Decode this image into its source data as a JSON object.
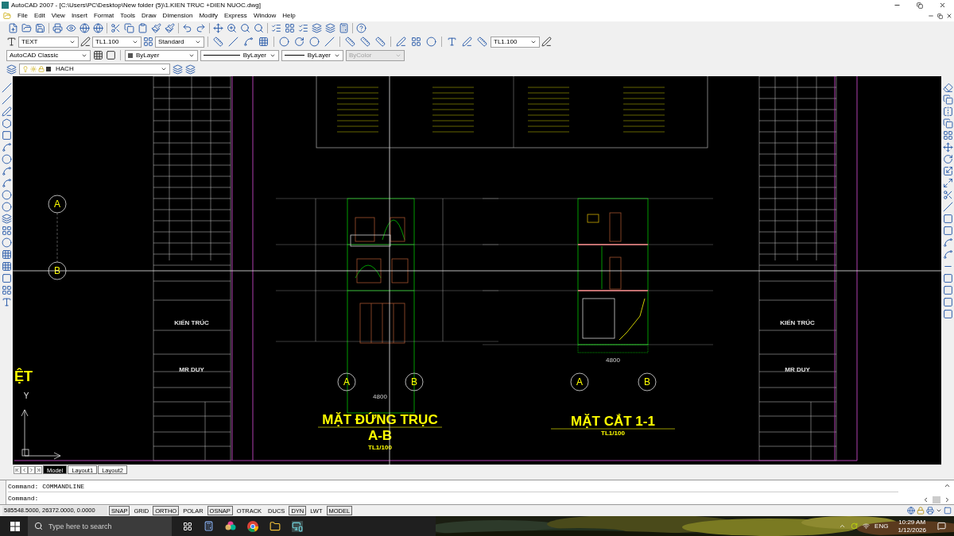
{
  "window": {
    "title": "AutoCAD 2007 - [C:\\Users\\PC\\Desktop\\New folder (5)\\1.KIEN TRUC +DIEN NUOC.dwg]"
  },
  "menu": [
    "File",
    "Edit",
    "View",
    "Insert",
    "Format",
    "Tools",
    "Draw",
    "Dimension",
    "Modify",
    "Express",
    "Window",
    "Help"
  ],
  "toolbars": {
    "text_style": "TEXT",
    "dim_style": "TL1.100",
    "table_style": "Standard",
    "multileader_style": "TL1.100",
    "workspace": "AutoCAD Classic",
    "object_color": "ByLayer",
    "linetype": "ByLayer",
    "lineweight": "ByLayer",
    "plot_style": {
      "value": "ByColor",
      "disabled": true
    },
    "layer": "HACH"
  },
  "drawing": {
    "left_label": "ỆT",
    "ucs_label": "Y",
    "grid_axes": [
      "A",
      "B"
    ],
    "views": [
      {
        "kind": "elevation",
        "title": "MẶT ĐỨNG TRỤC",
        "subtitle": "A-B",
        "scale": "TL1/100",
        "axes": [
          "A",
          "B"
        ],
        "dimension": "4800"
      },
      {
        "kind": "section",
        "title": "MẶT CẮT 1-1",
        "scale": "TL1/100",
        "axes": [
          "A",
          "B"
        ],
        "dimension": "4800"
      }
    ],
    "title_blocks": [
      {
        "discipline": "KIẾN TRÚC",
        "designer": "MR DUY"
      },
      {
        "discipline": "KIẾN TRÚC",
        "designer": "MR DUY"
      }
    ]
  },
  "layout_tabs": [
    {
      "label": "Model",
      "selected": true
    },
    {
      "label": "Layout1",
      "selected": false
    },
    {
      "label": "Layout2",
      "selected": false
    }
  ],
  "command_lines": [
    "Command: COMMANDLINE",
    "Command:"
  ],
  "status_bar": {
    "coordinates": "585548.5000, 26372.0000, 0.0000",
    "toggles": [
      {
        "label": "SNAP",
        "on": true
      },
      {
        "label": "GRID",
        "on": false
      },
      {
        "label": "ORTHO",
        "on": true
      },
      {
        "label": "POLAR",
        "on": false
      },
      {
        "label": "OSNAP",
        "on": true
      },
      {
        "label": "OTRACK",
        "on": false
      },
      {
        "label": "DUCS",
        "on": false
      },
      {
        "label": "DYN",
        "on": true
      },
      {
        "label": "LWT",
        "on": false
      },
      {
        "label": "MODEL",
        "on": true
      }
    ]
  },
  "taskbar": {
    "search": {
      "placeholder": "Type here to search"
    },
    "language": "ENG",
    "time": "10:29 AM",
    "date": "1/12/2026"
  }
}
